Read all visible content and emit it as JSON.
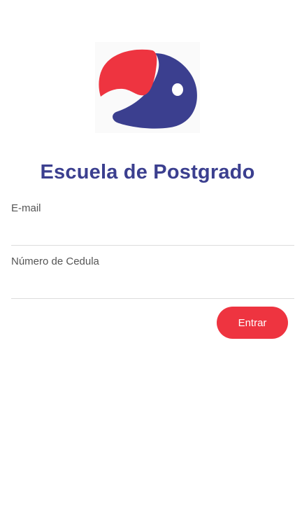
{
  "header": {
    "logo_icon": "fish-logo-icon",
    "title": "Escuela de Postgrado"
  },
  "form": {
    "email": {
      "label": "E-mail",
      "value": "",
      "placeholder": ""
    },
    "cedula": {
      "label": "Número de Cedula",
      "value": "",
      "placeholder": ""
    },
    "submit_label": "Entrar"
  },
  "colors": {
    "brand_blue": "#3b3f8f",
    "brand_red": "#ee3440",
    "background": "#ffffff"
  }
}
